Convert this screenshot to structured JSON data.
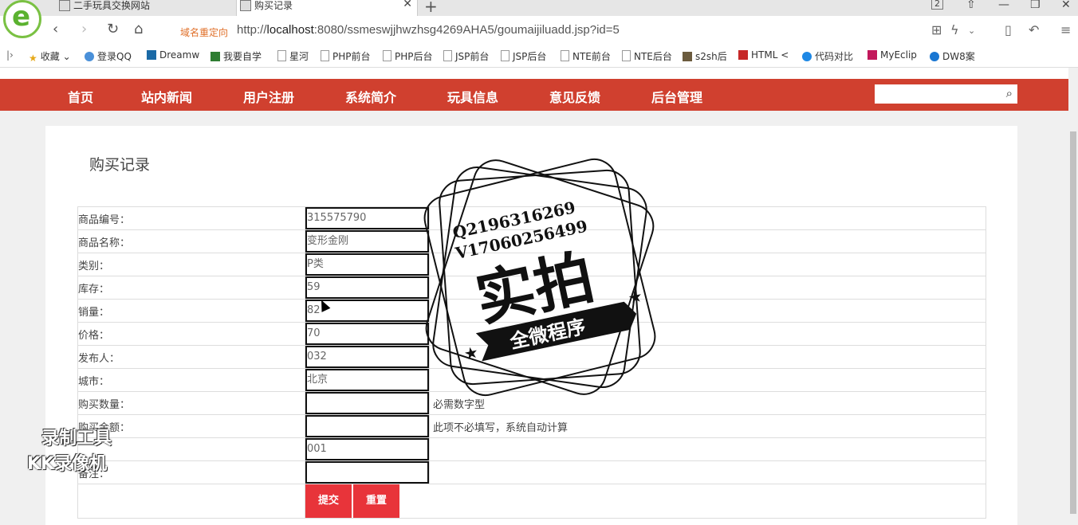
{
  "browser": {
    "tabs": [
      {
        "label": "二手玩具交换网站"
      },
      {
        "label": "购买记录"
      }
    ],
    "tab_count": "2",
    "redirect_label": "域名重定向",
    "url_prefix": "http://",
    "url_host": "localhost",
    "url_rest": ":8080/ssmeswjjhwzhsg4269AHA5/goumaijiluadd.jsp?id=5",
    "bookmarks": [
      {
        "label": "收藏",
        "icon": "star-icon"
      },
      {
        "label": "登录QQ",
        "icon": "qq-icon"
      },
      {
        "label": "Dreamw",
        "icon": "dw-icon"
      },
      {
        "label": "我要自学",
        "icon": "book-icon"
      },
      {
        "label": "星河",
        "icon": "page-icon"
      },
      {
        "label": "PHP前台",
        "icon": "page-icon"
      },
      {
        "label": "PHP后台",
        "icon": "page-icon"
      },
      {
        "label": "JSP前台",
        "icon": "page-icon"
      },
      {
        "label": "JSP后台",
        "icon": "page-icon"
      },
      {
        "label": "NTE前台",
        "icon": "page-icon"
      },
      {
        "label": "NTE后台",
        "icon": "page-icon"
      },
      {
        "label": "s2sh后",
        "icon": "img-icon"
      },
      {
        "label": "HTML <",
        "icon": "html-icon"
      },
      {
        "label": "代码对比",
        "icon": "compare-icon"
      },
      {
        "label": "MyEclip",
        "icon": "myeclipse-icon"
      },
      {
        "label": "DW8案",
        "icon": "paw-icon"
      }
    ]
  },
  "site": {
    "nav": [
      "首页",
      "站内新闻",
      "用户注册",
      "系统简介",
      "玩具信息",
      "意见反馈",
      "后台管理"
    ],
    "search_placeholder": ""
  },
  "page": {
    "title": "购买记录",
    "fields": [
      {
        "label": "商品编号：",
        "value": "315575790",
        "note": ""
      },
      {
        "label": "商品名称：",
        "value": "变形金刚",
        "note": ""
      },
      {
        "label": "类别：",
        "value": "P类",
        "note": ""
      },
      {
        "label": "库存：",
        "value": "59",
        "note": ""
      },
      {
        "label": "销量：",
        "value": "82",
        "note": ""
      },
      {
        "label": "价格：",
        "value": "70",
        "note": ""
      },
      {
        "label": "发布人：",
        "value": "032",
        "note": ""
      },
      {
        "label": "城市：",
        "value": "北京",
        "note": ""
      },
      {
        "label": "购买数量：",
        "value": "",
        "note": "必需数字型"
      },
      {
        "label": "购买金额：",
        "value": "",
        "note": "此项不必填写，系统自动计算"
      },
      {
        "label": "",
        "value": "001",
        "note": ""
      },
      {
        "label": "备注：",
        "value": "",
        "note": ""
      }
    ],
    "submit_label": "提交",
    "reset_label": "重置"
  },
  "overlay": {
    "stamp_line1": "Q2196316269",
    "stamp_line2": "V1706025649",
    "stamp_line2_end": "9",
    "stamp_big": "实拍",
    "stamp_banner": "全微程序",
    "watermark_line1": "录制工具",
    "watermark_line2": "KK录像机"
  },
  "colors": {
    "nav_bg": "#d0402f",
    "button_bg": "#e8343a"
  }
}
